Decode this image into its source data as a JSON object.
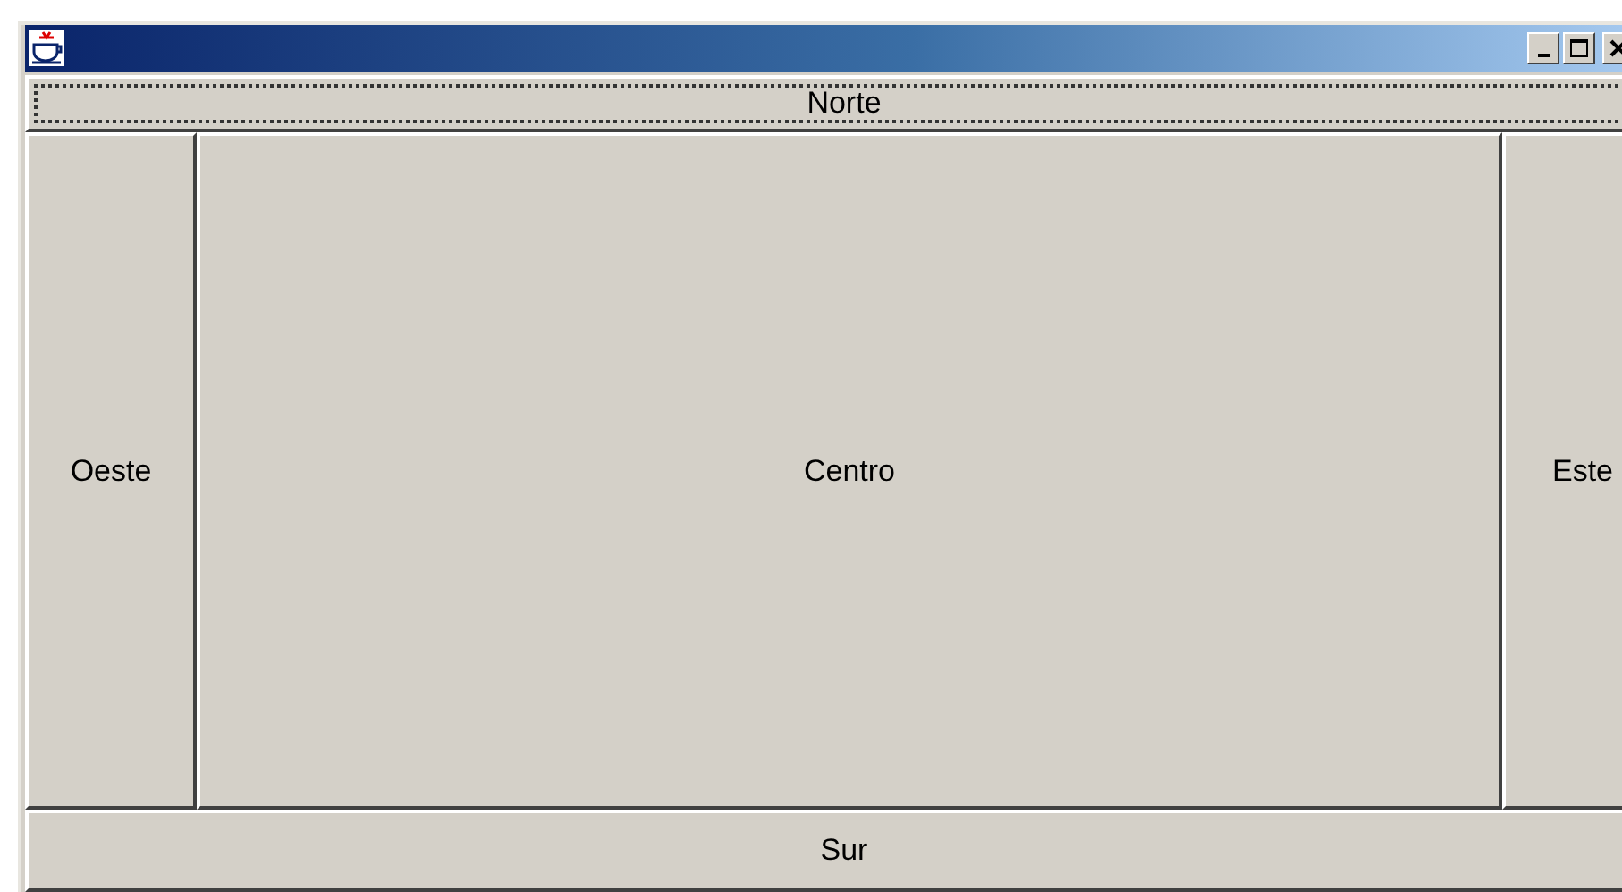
{
  "window": {
    "controls": [
      {
        "kind": "minimize"
      },
      {
        "kind": "maximize"
      },
      {
        "kind": "close"
      }
    ]
  },
  "regions": [
    {
      "kind": "north",
      "label": "Norte",
      "focused": true
    },
    {
      "kind": "west",
      "label": "Oeste",
      "focused": false
    },
    {
      "kind": "center",
      "label": "Centro",
      "focused": false
    },
    {
      "kind": "east",
      "label": "Este",
      "focused": false
    },
    {
      "kind": "south",
      "label": "Sur",
      "focused": false
    }
  ]
}
